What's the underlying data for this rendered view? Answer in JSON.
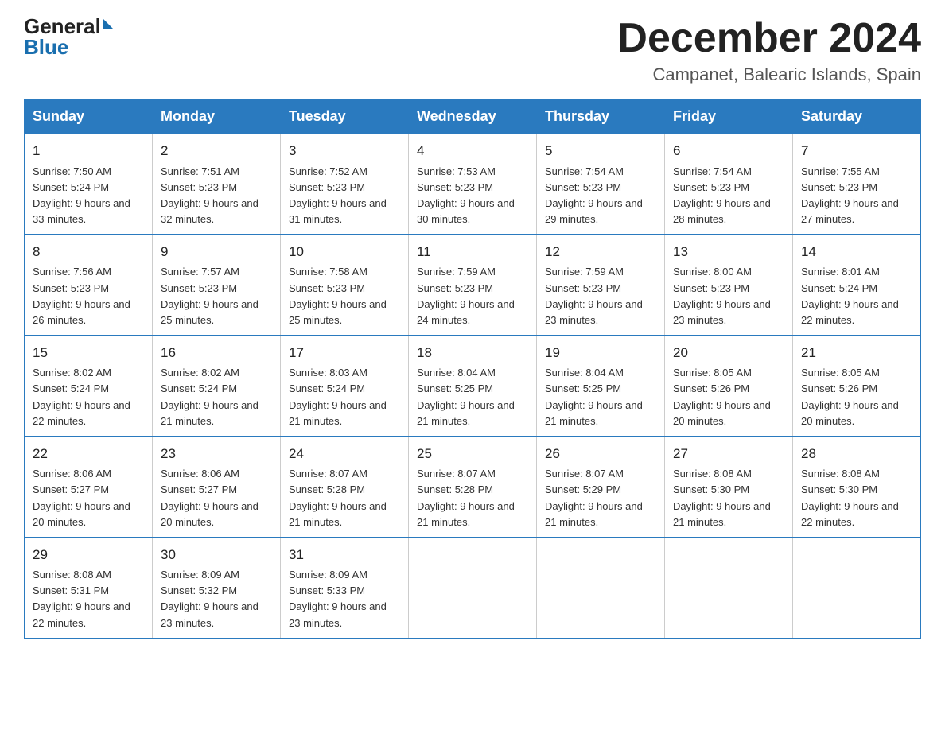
{
  "logo": {
    "general": "General",
    "blue": "Blue"
  },
  "title": "December 2024",
  "subtitle": "Campanet, Balearic Islands, Spain",
  "days_of_week": [
    "Sunday",
    "Monday",
    "Tuesday",
    "Wednesday",
    "Thursday",
    "Friday",
    "Saturday"
  ],
  "weeks": [
    [
      {
        "day": "1",
        "sunrise": "7:50 AM",
        "sunset": "5:24 PM",
        "daylight": "9 hours and 33 minutes."
      },
      {
        "day": "2",
        "sunrise": "7:51 AM",
        "sunset": "5:23 PM",
        "daylight": "9 hours and 32 minutes."
      },
      {
        "day": "3",
        "sunrise": "7:52 AM",
        "sunset": "5:23 PM",
        "daylight": "9 hours and 31 minutes."
      },
      {
        "day": "4",
        "sunrise": "7:53 AM",
        "sunset": "5:23 PM",
        "daylight": "9 hours and 30 minutes."
      },
      {
        "day": "5",
        "sunrise": "7:54 AM",
        "sunset": "5:23 PM",
        "daylight": "9 hours and 29 minutes."
      },
      {
        "day": "6",
        "sunrise": "7:54 AM",
        "sunset": "5:23 PM",
        "daylight": "9 hours and 28 minutes."
      },
      {
        "day": "7",
        "sunrise": "7:55 AM",
        "sunset": "5:23 PM",
        "daylight": "9 hours and 27 minutes."
      }
    ],
    [
      {
        "day": "8",
        "sunrise": "7:56 AM",
        "sunset": "5:23 PM",
        "daylight": "9 hours and 26 minutes."
      },
      {
        "day": "9",
        "sunrise": "7:57 AM",
        "sunset": "5:23 PM",
        "daylight": "9 hours and 25 minutes."
      },
      {
        "day": "10",
        "sunrise": "7:58 AM",
        "sunset": "5:23 PM",
        "daylight": "9 hours and 25 minutes."
      },
      {
        "day": "11",
        "sunrise": "7:59 AM",
        "sunset": "5:23 PM",
        "daylight": "9 hours and 24 minutes."
      },
      {
        "day": "12",
        "sunrise": "7:59 AM",
        "sunset": "5:23 PM",
        "daylight": "9 hours and 23 minutes."
      },
      {
        "day": "13",
        "sunrise": "8:00 AM",
        "sunset": "5:23 PM",
        "daylight": "9 hours and 23 minutes."
      },
      {
        "day": "14",
        "sunrise": "8:01 AM",
        "sunset": "5:24 PM",
        "daylight": "9 hours and 22 minutes."
      }
    ],
    [
      {
        "day": "15",
        "sunrise": "8:02 AM",
        "sunset": "5:24 PM",
        "daylight": "9 hours and 22 minutes."
      },
      {
        "day": "16",
        "sunrise": "8:02 AM",
        "sunset": "5:24 PM",
        "daylight": "9 hours and 21 minutes."
      },
      {
        "day": "17",
        "sunrise": "8:03 AM",
        "sunset": "5:24 PM",
        "daylight": "9 hours and 21 minutes."
      },
      {
        "day": "18",
        "sunrise": "8:04 AM",
        "sunset": "5:25 PM",
        "daylight": "9 hours and 21 minutes."
      },
      {
        "day": "19",
        "sunrise": "8:04 AM",
        "sunset": "5:25 PM",
        "daylight": "9 hours and 21 minutes."
      },
      {
        "day": "20",
        "sunrise": "8:05 AM",
        "sunset": "5:26 PM",
        "daylight": "9 hours and 20 minutes."
      },
      {
        "day": "21",
        "sunrise": "8:05 AM",
        "sunset": "5:26 PM",
        "daylight": "9 hours and 20 minutes."
      }
    ],
    [
      {
        "day": "22",
        "sunrise": "8:06 AM",
        "sunset": "5:27 PM",
        "daylight": "9 hours and 20 minutes."
      },
      {
        "day": "23",
        "sunrise": "8:06 AM",
        "sunset": "5:27 PM",
        "daylight": "9 hours and 20 minutes."
      },
      {
        "day": "24",
        "sunrise": "8:07 AM",
        "sunset": "5:28 PM",
        "daylight": "9 hours and 21 minutes."
      },
      {
        "day": "25",
        "sunrise": "8:07 AM",
        "sunset": "5:28 PM",
        "daylight": "9 hours and 21 minutes."
      },
      {
        "day": "26",
        "sunrise": "8:07 AM",
        "sunset": "5:29 PM",
        "daylight": "9 hours and 21 minutes."
      },
      {
        "day": "27",
        "sunrise": "8:08 AM",
        "sunset": "5:30 PM",
        "daylight": "9 hours and 21 minutes."
      },
      {
        "day": "28",
        "sunrise": "8:08 AM",
        "sunset": "5:30 PM",
        "daylight": "9 hours and 22 minutes."
      }
    ],
    [
      {
        "day": "29",
        "sunrise": "8:08 AM",
        "sunset": "5:31 PM",
        "daylight": "9 hours and 22 minutes."
      },
      {
        "day": "30",
        "sunrise": "8:09 AM",
        "sunset": "5:32 PM",
        "daylight": "9 hours and 23 minutes."
      },
      {
        "day": "31",
        "sunrise": "8:09 AM",
        "sunset": "5:33 PM",
        "daylight": "9 hours and 23 minutes."
      },
      null,
      null,
      null,
      null
    ]
  ]
}
